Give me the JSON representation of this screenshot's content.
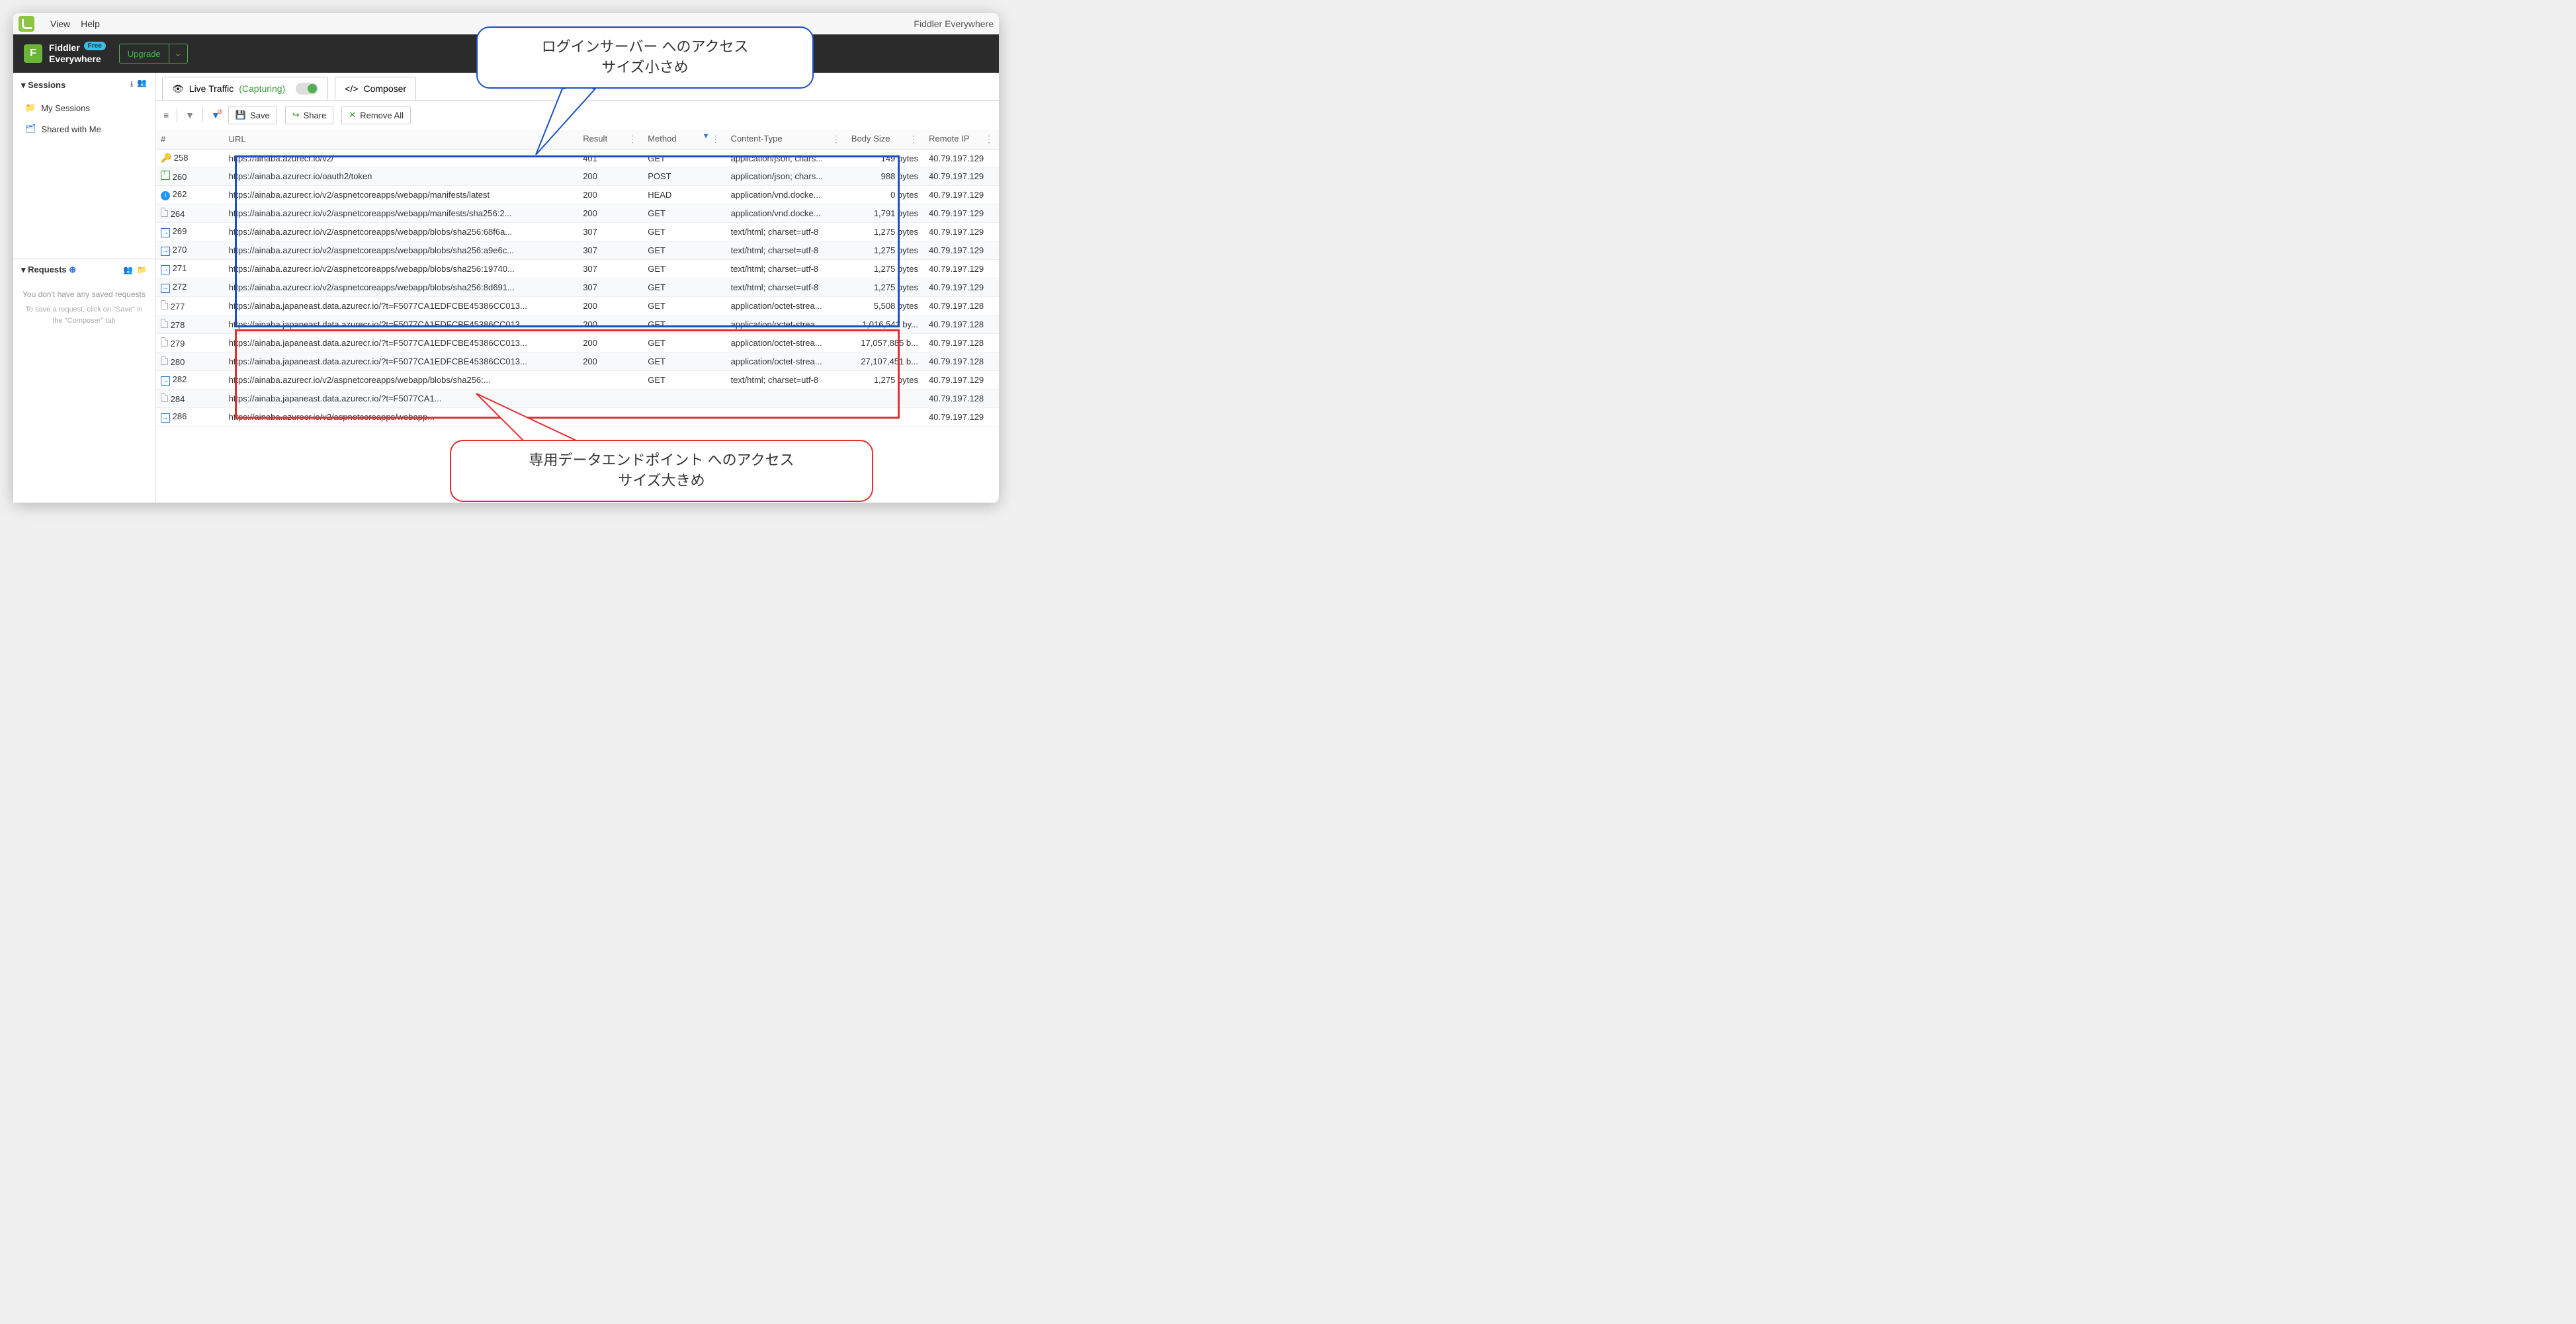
{
  "menubar": {
    "view": "View",
    "help": "Help",
    "app_title_right": "Fiddler Everywhere"
  },
  "brand": {
    "line1": "Fiddler",
    "line2": "Everywhere",
    "badge": "Free"
  },
  "upgrade": "Upgrade",
  "sidebar": {
    "sessions": "Sessions",
    "my_sessions": "My Sessions",
    "shared": "Shared with Me",
    "requests": "Requests",
    "help1": "You don't have any saved requests",
    "help2": "To save a request, click on \"Save\" in the \"Composer\" tab"
  },
  "tabs": {
    "live": "Live Traffic",
    "capturing": "(Capturing)",
    "composer": "Composer"
  },
  "toolbar": {
    "save": "Save",
    "share": "Share",
    "remove": "Remove All"
  },
  "columns": {
    "num": "#",
    "url": "URL",
    "result": "Result",
    "method": "Method",
    "ct": "Content-Type",
    "bs": "Body Size",
    "ip": "Remote IP"
  },
  "rows": [
    {
      "icon": "key",
      "n": "258",
      "url": "https://ainaba.azurecr.io/v2/",
      "res": "401",
      "m": "GET",
      "ct": "application/json; chars...",
      "bs": "149 bytes",
      "ip": "40.79.197.129",
      "hl": true
    },
    {
      "icon": "upload",
      "n": "260",
      "url": "https://ainaba.azurecr.io/oauth2/token",
      "res": "200",
      "m": "POST",
      "ct": "application/json; chars...",
      "bs": "988 bytes",
      "ip": "40.79.197.129"
    },
    {
      "icon": "info",
      "n": "262",
      "url": "https://ainaba.azurecr.io/v2/aspnetcoreapps/webapp/manifests/latest",
      "res": "200",
      "m": "HEAD",
      "ct": "application/vnd.docke...",
      "bs": "0 bytes",
      "ip": "40.79.197.129"
    },
    {
      "icon": "doc",
      "n": "264",
      "url": "https://ainaba.azurecr.io/v2/aspnetcoreapps/webapp/manifests/sha256:2...",
      "res": "200",
      "m": "GET",
      "ct": "application/vnd.docke...",
      "bs": "1,791 bytes",
      "ip": "40.79.197.129"
    },
    {
      "icon": "arrow",
      "n": "269",
      "url": "https://ainaba.azurecr.io/v2/aspnetcoreapps/webapp/blobs/sha256:68f6a...",
      "res": "307",
      "m": "GET",
      "ct": "text/html; charset=utf-8",
      "bs": "1,275 bytes",
      "ip": "40.79.197.129"
    },
    {
      "icon": "arrow",
      "n": "270",
      "url": "https://ainaba.azurecr.io/v2/aspnetcoreapps/webapp/blobs/sha256:a9e6c...",
      "res": "307",
      "m": "GET",
      "ct": "text/html; charset=utf-8",
      "bs": "1,275 bytes",
      "ip": "40.79.197.129"
    },
    {
      "icon": "arrow",
      "n": "271",
      "url": "https://ainaba.azurecr.io/v2/aspnetcoreapps/webapp/blobs/sha256:19740...",
      "res": "307",
      "m": "GET",
      "ct": "text/html; charset=utf-8",
      "bs": "1,275 bytes",
      "ip": "40.79.197.129"
    },
    {
      "icon": "arrow",
      "n": "272",
      "url": "https://ainaba.azurecr.io/v2/aspnetcoreapps/webapp/blobs/sha256:8d691...",
      "res": "307",
      "m": "GET",
      "ct": "text/html; charset=utf-8",
      "bs": "1,275 bytes",
      "ip": "40.79.197.129"
    },
    {
      "icon": "doc",
      "n": "277",
      "url": "https://ainaba.japaneast.data.azurecr.io/?t=F5077CA1EDFCBE45386CC013...",
      "res": "200",
      "m": "GET",
      "ct": "application/octet-strea...",
      "bs": "5,508 bytes",
      "ip": "40.79.197.128"
    },
    {
      "icon": "doc",
      "n": "278",
      "url": "https://ainaba.japaneast.data.azurecr.io/?t=F5077CA1EDFCBE45386CC013...",
      "res": "200",
      "m": "GET",
      "ct": "application/octet-strea...",
      "bs": "1,016,541 by...",
      "ip": "40.79.197.128"
    },
    {
      "icon": "doc",
      "n": "279",
      "url": "https://ainaba.japaneast.data.azurecr.io/?t=F5077CA1EDFCBE45386CC013...",
      "res": "200",
      "m": "GET",
      "ct": "application/octet-strea...",
      "bs": "17,057,885 b...",
      "ip": "40.79.197.128"
    },
    {
      "icon": "doc",
      "n": "280",
      "url": "https://ainaba.japaneast.data.azurecr.io/?t=F5077CA1EDFCBE45386CC013...",
      "res": "200",
      "m": "GET",
      "ct": "application/octet-strea...",
      "bs": "27,107,451 b...",
      "ip": "40.79.197.128"
    },
    {
      "icon": "arrow",
      "n": "282",
      "url": "https://ainaba.azurecr.io/v2/aspnetcoreapps/webapp/blobs/sha256:...",
      "res": "",
      "m": "GET",
      "ct": "text/html; charset=utf-8",
      "bs": "1,275 bytes",
      "ip": "40.79.197.129"
    },
    {
      "icon": "doc",
      "n": "284",
      "url": "https://ainaba.japaneast.data.azurecr.io/?t=F5077CA1...",
      "res": "",
      "m": "",
      "ct": "",
      "bs": "",
      "ip": "40.79.197.128"
    },
    {
      "icon": "arrow",
      "n": "286",
      "url": "https://ainaba.azurecr.io/v2/aspnetcoreapps/webapp...",
      "res": "",
      "m": "",
      "ct": "",
      "bs": "",
      "ip": "40.79.197.129"
    }
  ],
  "callout_blue": {
    "l1": "ログインサーバー へのアクセス",
    "l2": "サイズ小さめ"
  },
  "callout_red": {
    "l1": "専用データエンドポイント へのアクセス",
    "l2": "サイズ大きめ"
  }
}
